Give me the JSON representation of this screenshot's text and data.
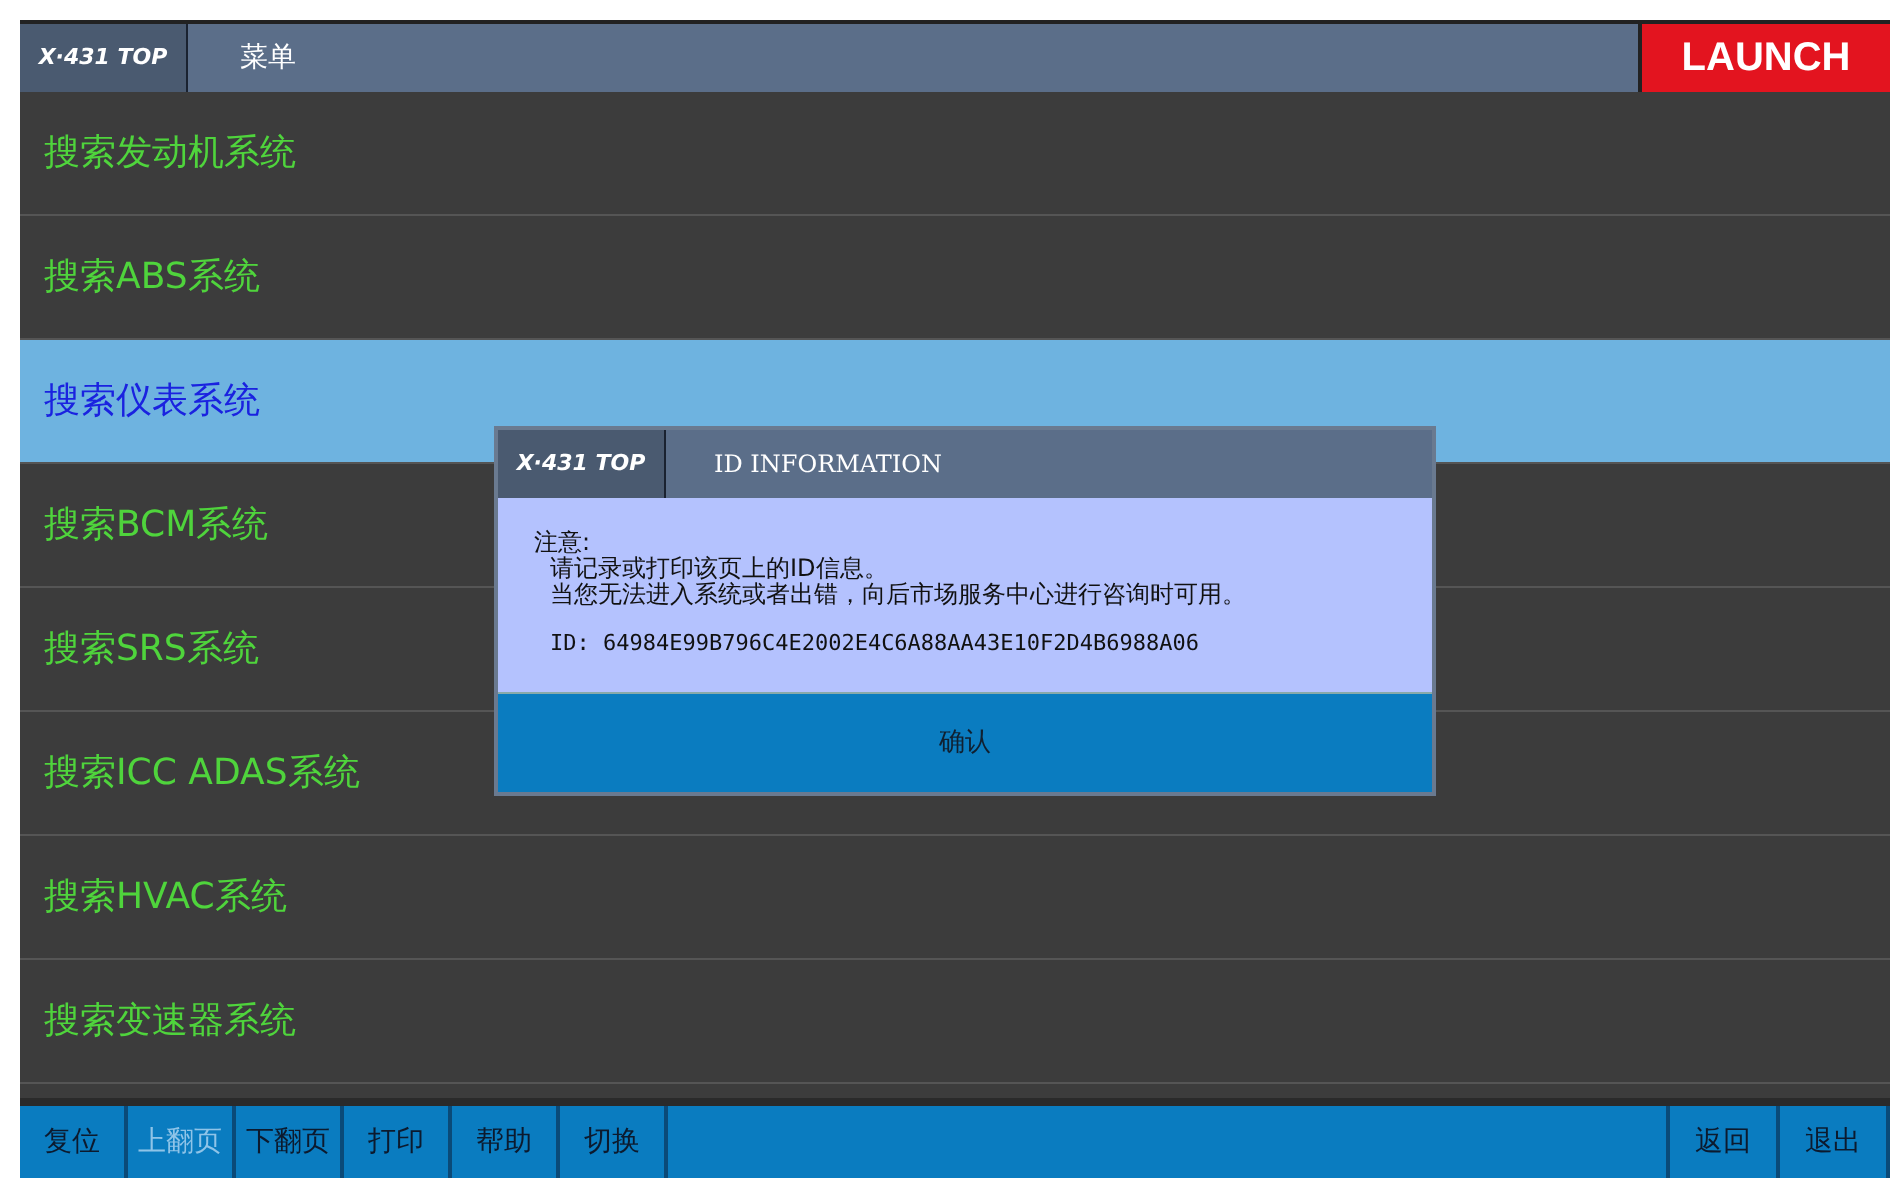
{
  "header": {
    "logo": "X·431 TOP",
    "title": "菜单",
    "brand": "LAUNCH"
  },
  "menu": [
    {
      "label": "搜索发动机系统",
      "selected": false
    },
    {
      "label": "搜索ABS系统",
      "selected": false
    },
    {
      "label": "搜索仪表系统",
      "selected": true
    },
    {
      "label": "搜索BCM系统",
      "selected": false
    },
    {
      "label": "搜索SRS系统",
      "selected": false
    },
    {
      "label": "搜索ICC ADAS系统",
      "selected": false
    },
    {
      "label": "搜索HVAC系统",
      "selected": false
    },
    {
      "label": "搜索变速器系统",
      "selected": false
    }
  ],
  "dialog": {
    "logo": "X·431 TOP",
    "title": "ID INFORMATION",
    "heading": "注意:",
    "lines": [
      "请记录或打印该页上的ID信息。",
      "当您无法进入系统或者出错，向后市场服务中心进行咨询时可用。"
    ],
    "id": "ID: 64984E99B796C4E2002E4C6A88AA43E10F2D4B6988A06",
    "button": "确认"
  },
  "toolbar": {
    "left": [
      {
        "label": "复位",
        "disabled": false
      },
      {
        "label": "上翻页",
        "disabled": true
      },
      {
        "label": "下翻页",
        "disabled": false
      },
      {
        "label": "打印",
        "disabled": false
      },
      {
        "label": "帮助",
        "disabled": false
      },
      {
        "label": "切换",
        "disabled": false
      }
    ],
    "right": [
      {
        "label": "返回",
        "disabled": false
      },
      {
        "label": "退出",
        "disabled": false
      }
    ]
  }
}
